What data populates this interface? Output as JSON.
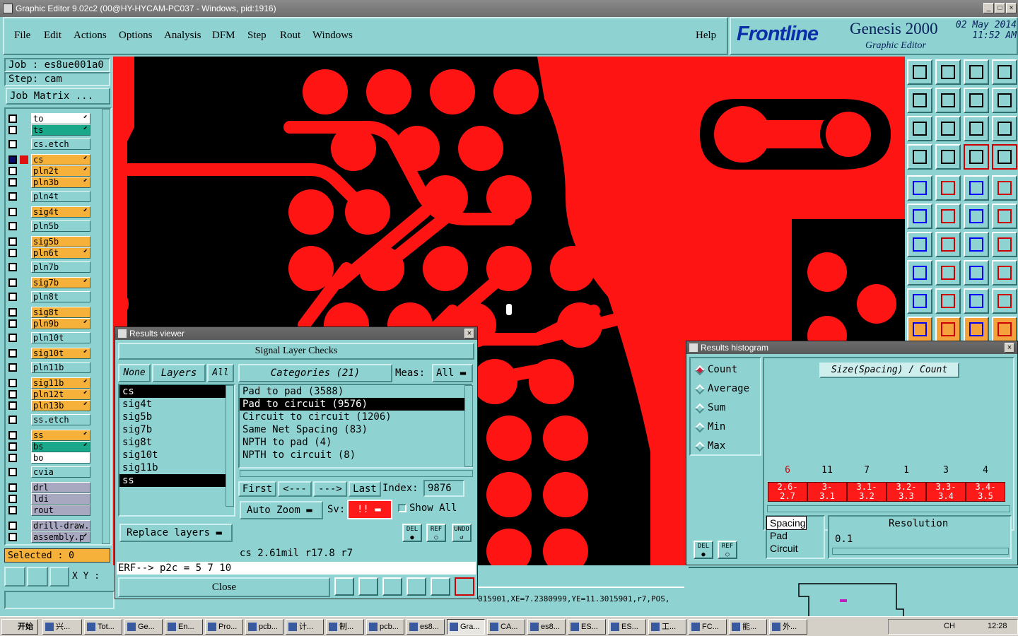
{
  "window": {
    "title": "Graphic Editor 9.02c2 (00@HY-HYCAM-PC037 - Windows, pid:1916)"
  },
  "menu": [
    "File",
    "Edit",
    "Actions",
    "Options",
    "Analysis",
    "DFM",
    "Step",
    "Rout",
    "Windows"
  ],
  "help": "Help",
  "brand": {
    "logo": "Frontline",
    "product": "Genesis 2000",
    "subtitle": "Graphic Editor",
    "date": "02 May 2014",
    "time": "11:52 AM"
  },
  "job": {
    "job": "Job : es8ue001a0",
    "step": "Step: cam",
    "matrix": "Job Matrix ..."
  },
  "layers": [
    {
      "name": "to",
      "color": "#ffffff",
      "arrow": true
    },
    {
      "name": "ts",
      "color": "#1aa88a",
      "arrow": true
    },
    {
      "name": "cs.etch",
      "color": "#8fd2d2",
      "arrow": false
    },
    {
      "name": "cs",
      "color": "#f6b13a",
      "arrow": true,
      "active": true
    },
    {
      "name": "pln2t",
      "color": "#f6b13a",
      "arrow": true
    },
    {
      "name": "pln3b",
      "color": "#f6b13a",
      "arrow": true
    },
    {
      "name": "pln4t",
      "color": "#8fd2d2",
      "arrow": false
    },
    {
      "name": "sig4t",
      "color": "#f6b13a",
      "arrow": true
    },
    {
      "name": "pln5b",
      "color": "#8fd2d2",
      "arrow": false
    },
    {
      "name": "sig5b",
      "color": "#f6b13a",
      "arrow": false
    },
    {
      "name": "pln6t",
      "color": "#f6b13a",
      "arrow": true
    },
    {
      "name": "pln7b",
      "color": "#8fd2d2",
      "arrow": false
    },
    {
      "name": "sig7b",
      "color": "#f6b13a",
      "arrow": true
    },
    {
      "name": "pln8t",
      "color": "#8fd2d2",
      "arrow": false
    },
    {
      "name": "sig8t",
      "color": "#f6b13a",
      "arrow": false
    },
    {
      "name": "pln9b",
      "color": "#f6b13a",
      "arrow": true
    },
    {
      "name": "pln10t",
      "color": "#8fd2d2",
      "arrow": false
    },
    {
      "name": "sig10t",
      "color": "#f6b13a",
      "arrow": true
    },
    {
      "name": "pln11b",
      "color": "#8fd2d2",
      "arrow": false
    },
    {
      "name": "sig11b",
      "color": "#f6b13a",
      "arrow": true
    },
    {
      "name": "pln12t",
      "color": "#f6b13a",
      "arrow": true
    },
    {
      "name": "pln13b",
      "color": "#f6b13a",
      "arrow": true
    },
    {
      "name": "ss.etch",
      "color": "#8fd2d2",
      "arrow": false
    },
    {
      "name": "ss",
      "color": "#f6b13a",
      "arrow": true
    },
    {
      "name": "bs",
      "color": "#1aa88a",
      "arrow": true
    },
    {
      "name": "bo",
      "color": "#ffffff",
      "arrow": false
    },
    {
      "name": "cvia",
      "color": "#8fd2d2",
      "arrow": false
    },
    {
      "name": "drl",
      "color": "#a8a8c0",
      "arrow": false
    },
    {
      "name": "ldi",
      "color": "#a8a8c0",
      "arrow": false
    },
    {
      "name": "rout",
      "color": "#a8a8c0",
      "arrow": false
    },
    {
      "name": "drill-draw.",
      "color": "#a8a8c0",
      "arrow": false
    },
    {
      "name": "assembly.p",
      "color": "#a8a8c0",
      "arrow": true
    }
  ],
  "selected": "Selected : 0",
  "xy": "X Y :",
  "status_line": "015901,XE=7.2380999,YE=11.3015901,r7,POS,",
  "results_viewer": {
    "title": "Results viewer",
    "header": "Signal Layer Checks",
    "none": "None",
    "layers": "Layers",
    "all": "All",
    "categories": "Categories (21)",
    "meas_label": "Meas:",
    "meas_value": "All",
    "layer_list": [
      "cs",
      "sig4t",
      "sig5b",
      "sig7b",
      "sig8t",
      "sig10t",
      "sig11b",
      "ss"
    ],
    "category_list": [
      "Pad to pad (3588)",
      "Pad to circuit (9576)",
      "Circuit to circuit (1206)",
      "Same Net Spacing (83)",
      "NPTH to pad (4)",
      "NPTH to circuit (8)"
    ],
    "first": "First",
    "prev": "<---",
    "next": "--->",
    "last": "Last",
    "index_label": "Index:",
    "index_value": "9876",
    "auto_zoom": "Auto Zoom",
    "sv_label": "Sv:",
    "sv_value": "!!",
    "show_all": "Show All",
    "replace": "Replace layers",
    "del": "DEL",
    "ref": "REF",
    "undo": "UNDO",
    "measure": "cs 2.61mil  r17.8  r7",
    "erf": "ERF--> p2c = 5 7 10",
    "close": "Close"
  },
  "histogram": {
    "title": "Results histogram",
    "modes": [
      "Count",
      "Average",
      "Sum",
      "Min",
      "Max"
    ],
    "selected_mode": "Count",
    "chart_title": "Size(Spacing) / Count",
    "counts": [
      "6",
      "11",
      "7",
      "1",
      "3",
      "4"
    ],
    "bins": [
      "2.6-\n2.7",
      "3-\n3.1",
      "3.1-\n3.2",
      "3.2-\n3.3",
      "3.3-\n3.4",
      "3.4-\n3.5"
    ],
    "types": [
      "Spacing",
      "Pad",
      "Circuit"
    ],
    "resolution_label": "Resolution",
    "resolution_value": "0.1",
    "del": "DEL",
    "ref": "REF"
  },
  "taskbar": {
    "start": "开始",
    "items": [
      "兴...",
      "Tot...",
      "Ge...",
      "En...",
      "Pro...",
      "pcb...",
      "计...",
      "制...",
      "pcb...",
      "es8...",
      "Gra...",
      "CA...",
      "es8...",
      "ES...",
      "ES...",
      "工...",
      "FC...",
      "能...",
      "外..."
    ],
    "active_index": 10,
    "clock": "12:28",
    "lang": "CH"
  }
}
